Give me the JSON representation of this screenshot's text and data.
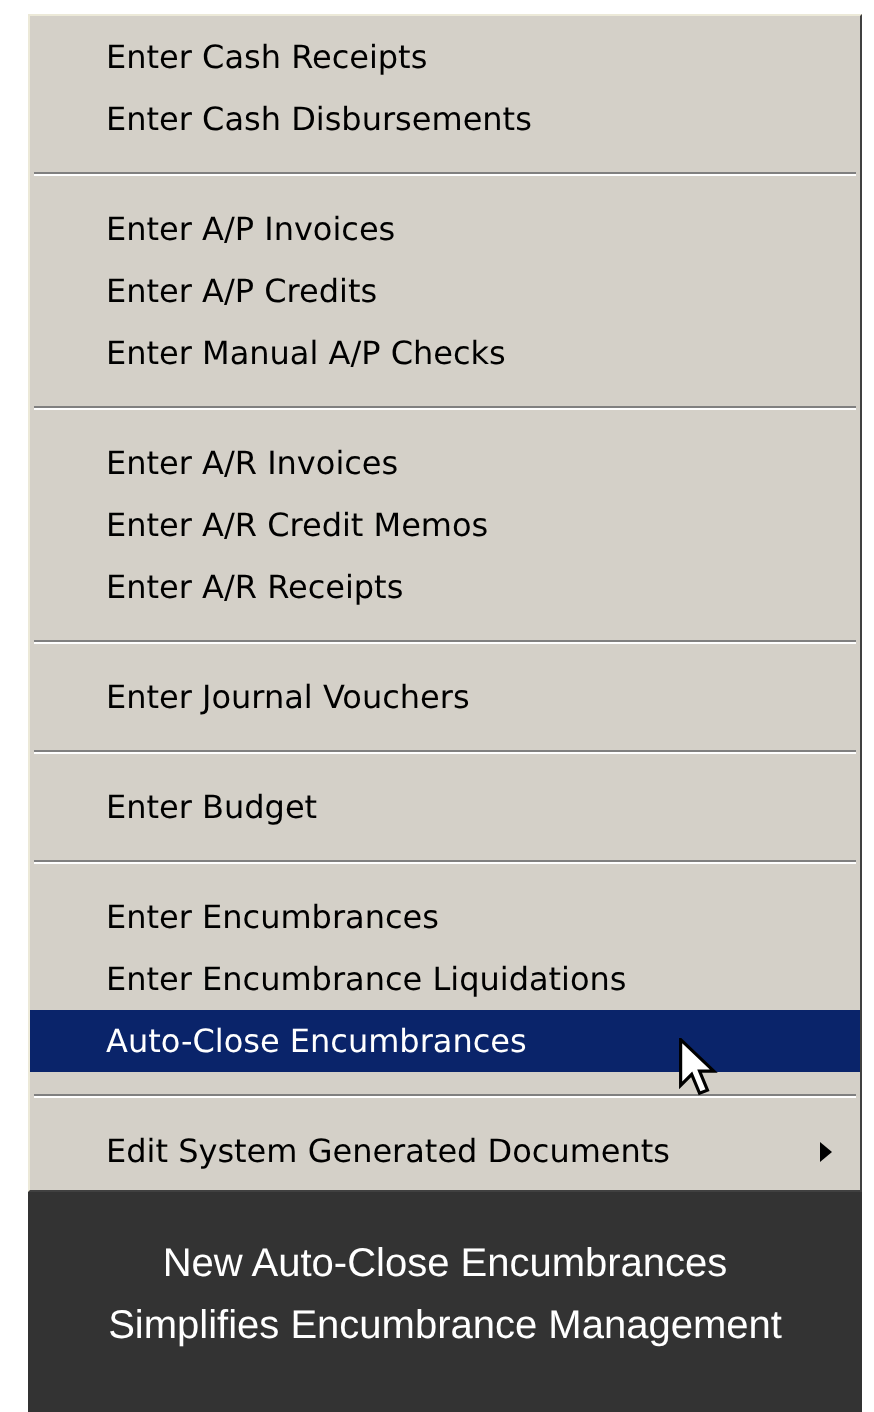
{
  "menu": {
    "sections": [
      {
        "items": [
          {
            "label": "Enter Cash Receipts",
            "kind": "action",
            "selected": false
          },
          {
            "label": "Enter Cash Disbursements",
            "kind": "action",
            "selected": false
          }
        ]
      },
      {
        "items": [
          {
            "label": "Enter A/P Invoices",
            "kind": "action",
            "selected": false
          },
          {
            "label": "Enter A/P Credits",
            "kind": "action",
            "selected": false
          },
          {
            "label": "Enter Manual A/P Checks",
            "kind": "action",
            "selected": false
          }
        ]
      },
      {
        "items": [
          {
            "label": "Enter A/R Invoices",
            "kind": "action",
            "selected": false
          },
          {
            "label": "Enter A/R Credit Memos",
            "kind": "action",
            "selected": false
          },
          {
            "label": "Enter A/R Receipts",
            "kind": "action",
            "selected": false
          }
        ]
      },
      {
        "items": [
          {
            "label": "Enter Journal Vouchers",
            "kind": "action",
            "selected": false
          }
        ]
      },
      {
        "items": [
          {
            "label": "Enter Budget",
            "kind": "action",
            "selected": false
          }
        ]
      },
      {
        "items": [
          {
            "label": "Enter Encumbrances",
            "kind": "action",
            "selected": false
          },
          {
            "label": "Enter Encumbrance Liquidations",
            "kind": "action",
            "selected": false
          },
          {
            "label": "Auto-Close Encumbrances",
            "kind": "action",
            "selected": true
          }
        ]
      },
      {
        "items": [
          {
            "label": "Edit System Generated Documents",
            "kind": "submenu",
            "selected": false
          }
        ]
      }
    ]
  },
  "caption": {
    "lines": [
      "New Auto-Close Encumbrances",
      "Simplifies Encumbrance Management"
    ]
  }
}
